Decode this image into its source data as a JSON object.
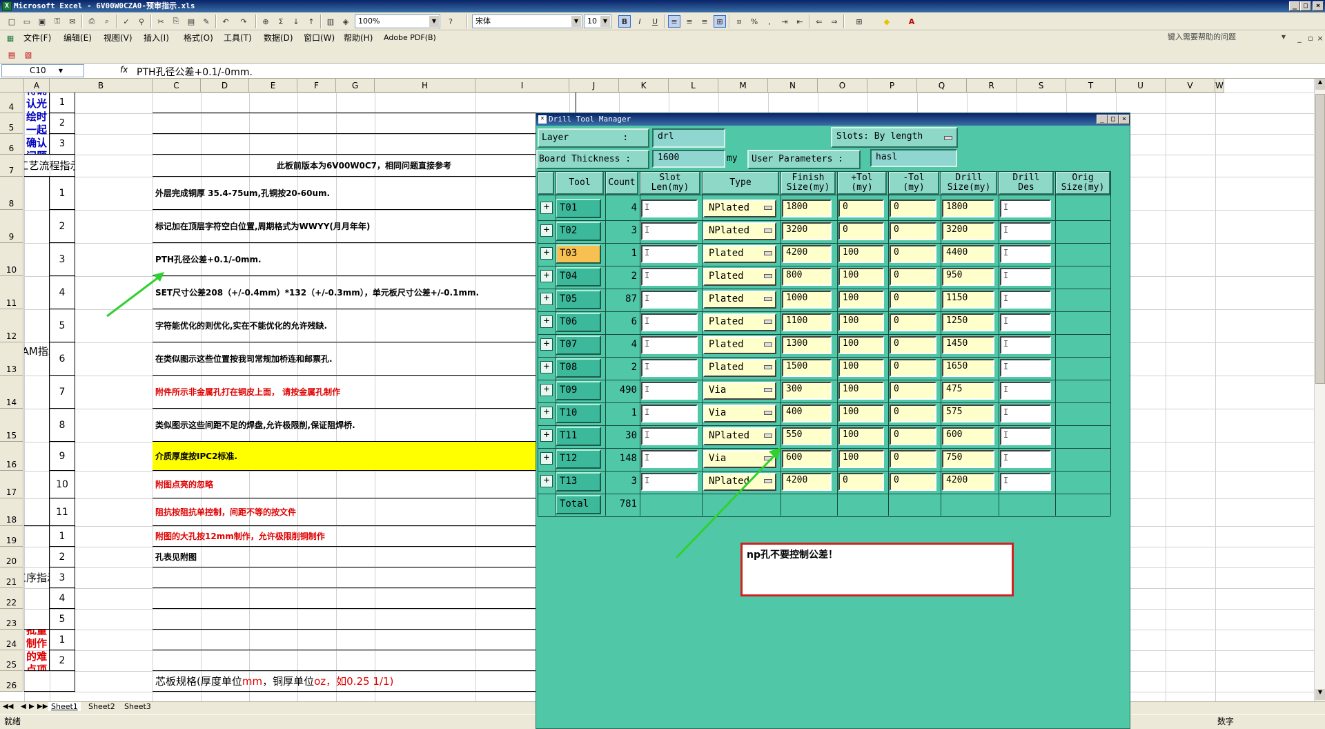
{
  "window": {
    "title": "Microsoft Excel - 6V00W0CZA0-预审指示.xls"
  },
  "toolbar": {
    "zoom": "100%",
    "font_name": "宋体",
    "font_size": "10"
  },
  "menu": {
    "items": [
      "文件(F)",
      "编辑(E)",
      "视图(V)",
      "插入(I)",
      "格式(O)",
      "工具(T)",
      "数据(D)",
      "窗口(W)",
      "帮助(H)",
      "Adobe PDF(B)"
    ],
    "help_placeholder": "键入需要帮助的问题"
  },
  "formula": {
    "cell_ref": "C10",
    "fx": "fx",
    "content": "PTH孔径公差+0.1/-0mm."
  },
  "columns": [
    "A",
    "B",
    "C",
    "D",
    "E",
    "F",
    "G",
    "H",
    "I",
    "J",
    "K",
    "L",
    "M",
    "N",
    "O",
    "P",
    "Q",
    "R",
    "S",
    "T",
    "U",
    "V",
    "W"
  ],
  "rows": [
    "4",
    "5",
    "6",
    "7",
    "8",
    "9",
    "10",
    "11",
    "12",
    "13",
    "14",
    "15",
    "16",
    "17",
    "18",
    "19",
    "20",
    "21",
    "22",
    "23",
    "24",
    "25",
    "26"
  ],
  "sheet": {
    "confirm_label": "待确认光绘时一起确认问题",
    "confirm_nums": [
      "1",
      "2",
      "3"
    ],
    "process_label": "工艺流程指示",
    "process_note": "此板前版本为6V00W0C7，相同问题直接参考",
    "cam_label": "CAM指示",
    "cam_items": [
      {
        "n": "1",
        "text": "外层完成铜厚 35.4-75um,孔铜按20-60um.",
        "color": "#000000"
      },
      {
        "n": "2",
        "text": "标记加在顶层字符空白位置,周期格式为WWYY(月月年年)",
        "color": "#000000"
      },
      {
        "n": "3",
        "text": "PTH孔径公差+0.1/-0mm.",
        "color": "#000000"
      },
      {
        "n": "4",
        "text": "SET尺寸公差208（+/-0.4mm）*132（+/-0.3mm），单元板尺寸公差+/-0.1mm.",
        "color": "#000000"
      },
      {
        "n": "5",
        "text": "字符能优化的则优化,实在不能优化的允许残缺.",
        "color": "#000000"
      },
      {
        "n": "6",
        "text": "在类似图示这些位置按我司常规加桥连和邮票孔.",
        "color": "#000000"
      },
      {
        "n": "7",
        "text": "附件所示非金属孔打在铜皮上面， 请按金属孔制作",
        "color": "#e00000"
      },
      {
        "n": "8",
        "text": "类似图示这些间距不足的焊盘,允许极限削,保证阻焊桥.",
        "color": "#000000"
      },
      {
        "n": "9",
        "text": "介质厚度按IPC2标准.",
        "color": "#000000"
      },
      {
        "n": "10",
        "text": "附图点亮的忽略",
        "color": "#e00000"
      },
      {
        "n": "11",
        "text": "阻抗按阻抗单控制，间距不等的按文件",
        "color": "#e00000"
      }
    ],
    "step_label": "工序指示",
    "step_items": [
      {
        "n": "1",
        "text": "附图的大孔按12mm制作，允许极限削铜制作",
        "color": "#e00000"
      },
      {
        "n": "2",
        "text": "孔表见附图",
        "color": "#000000"
      },
      {
        "n": "3",
        "text": "",
        "color": "#000000"
      },
      {
        "n": "4",
        "text": "",
        "color": "#000000"
      },
      {
        "n": "5",
        "text": "",
        "color": "#000000"
      }
    ],
    "difficult_label": "不可批量制作的难点项目",
    "difficult_nums": [
      "1",
      "2"
    ],
    "core_spec_a": "芯板规格(厚度单位",
    "core_spec_mm": "mm",
    "core_spec_b": "，铜厚单位",
    "core_spec_oz": "oz",
    "core_spec_c": "，如0.25 1/1)",
    "highlight_color": "#ffff00",
    "red_color": "#e00000",
    "blue_color": "#0000c0"
  },
  "tabs": [
    "Sheet1",
    "Sheet2",
    "Sheet3"
  ],
  "status": {
    "left": "就绪",
    "right": "数字"
  },
  "drill": {
    "title": "Drill Tool Manager",
    "layer_label": "Layer          :",
    "layer_value": "drl",
    "slots_label": "Slots:",
    "slots_value": "By length",
    "board_label": "Board Thickness :",
    "board_value": "1600",
    "board_unit": "my",
    "userparam_label": "User Parameters :",
    "userparam_value": "hasl",
    "headers": [
      "Tool",
      "Count",
      "Slot\nLen(my)",
      "Type",
      "Finish\nSize(my)",
      "+Tol\n(my)",
      "-Tol\n(my)",
      "Drill\nSize(my)",
      "Drill\nDes",
      "Orig\nSize(my)"
    ],
    "rows": [
      {
        "tool": "T01",
        "count": "4",
        "type": "NPlated",
        "finish": "1800",
        "ptol": "0",
        "ntol": "0",
        "drill": "1800"
      },
      {
        "tool": "T02",
        "count": "3",
        "type": "NPlated",
        "finish": "3200",
        "ptol": "0",
        "ntol": "0",
        "drill": "3200"
      },
      {
        "tool": "T03",
        "count": "1",
        "type": "Plated",
        "finish": "4200",
        "ptol": "100",
        "ntol": "0",
        "drill": "4400"
      },
      {
        "tool": "T04",
        "count": "2",
        "type": "Plated",
        "finish": "800",
        "ptol": "100",
        "ntol": "0",
        "drill": "950"
      },
      {
        "tool": "T05",
        "count": "87",
        "type": "Plated",
        "finish": "1000",
        "ptol": "100",
        "ntol": "0",
        "drill": "1150"
      },
      {
        "tool": "T06",
        "count": "6",
        "type": "Plated",
        "finish": "1100",
        "ptol": "100",
        "ntol": "0",
        "drill": "1250"
      },
      {
        "tool": "T07",
        "count": "4",
        "type": "Plated",
        "finish": "1300",
        "ptol": "100",
        "ntol": "0",
        "drill": "1450"
      },
      {
        "tool": "T08",
        "count": "2",
        "type": "Plated",
        "finish": "1500",
        "ptol": "100",
        "ntol": "0",
        "drill": "1650"
      },
      {
        "tool": "T09",
        "count": "490",
        "type": "Via",
        "finish": "300",
        "ptol": "100",
        "ntol": "0",
        "drill": "475"
      },
      {
        "tool": "T10",
        "count": "1",
        "type": "Via",
        "finish": "400",
        "ptol": "100",
        "ntol": "0",
        "drill": "575"
      },
      {
        "tool": "T11",
        "count": "30",
        "type": "NPlated",
        "finish": "550",
        "ptol": "100",
        "ntol": "0",
        "drill": "600"
      },
      {
        "tool": "T12",
        "count": "148",
        "type": "Via",
        "finish": "600",
        "ptol": "100",
        "ntol": "0",
        "drill": "750"
      },
      {
        "tool": "T13",
        "count": "3",
        "type": "NPlated",
        "finish": "4200",
        "ptol": "0",
        "ntol": "0",
        "drill": "4200"
      }
    ],
    "total_label": "Total",
    "total_value": "781",
    "selected_tool": "T03",
    "panel_color": "#50c8a8"
  },
  "note": {
    "text": "np孔不要控制公差！"
  }
}
